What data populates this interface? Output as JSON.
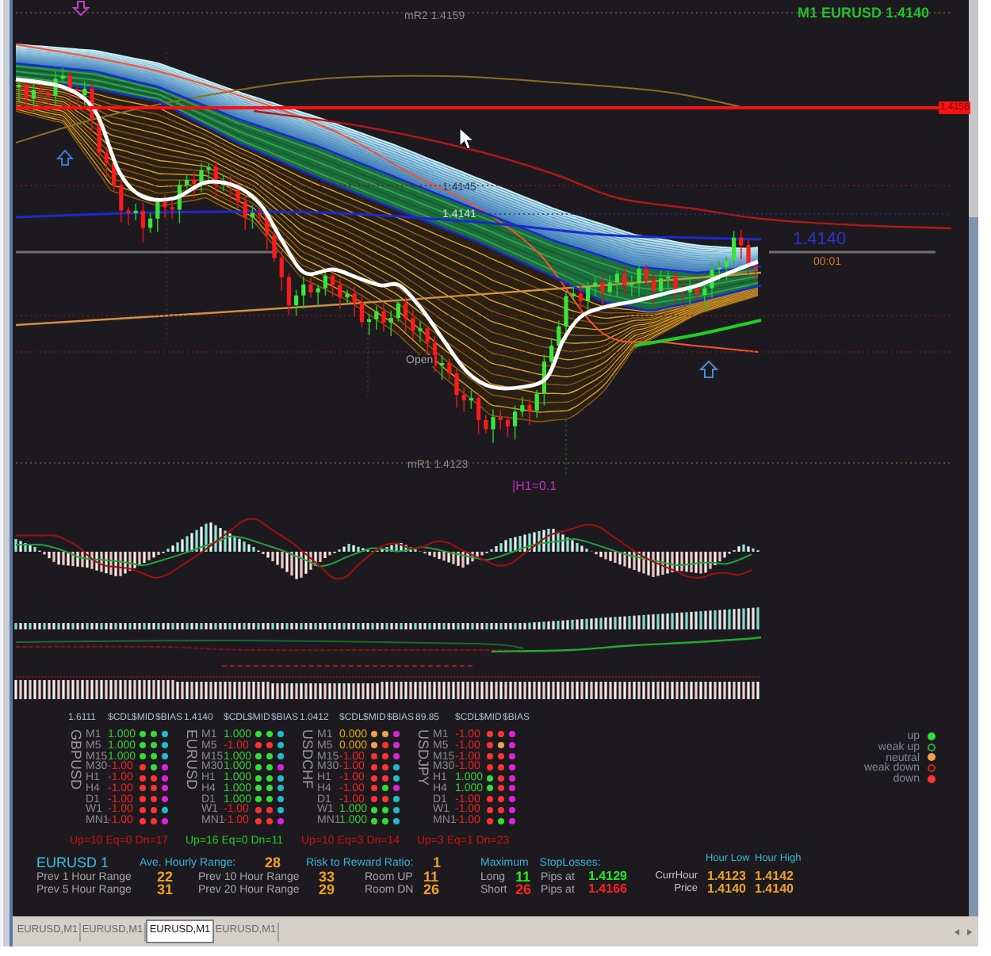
{
  "chart": {
    "title": "M1 EURUSD 1.4140",
    "levels": [
      {
        "label": "mR2 1.4159"
      },
      {
        "label": "1.4145"
      },
      {
        "label": "1.4141"
      },
      {
        "label": "Open"
      },
      {
        "label": "mR1 1.4123"
      }
    ],
    "price_tag": "1.4158",
    "current_price": "1.4140",
    "countdown": "00:01",
    "indicator_label": "|H1=0.1"
  },
  "pairs": [
    {
      "price": "1.6111",
      "columns": [
        "$CDL",
        "$MID",
        "$BIAS"
      ],
      "name": "GBPUSD",
      "rows": [
        {
          "timeframe": "M1",
          "value": "1.000",
          "color": "#33cc33",
          "dots": [
            {
              "color": "#33dd33"
            },
            {
              "color": "#33dd33"
            },
            {
              "color": "#22bbcc"
            }
          ]
        },
        {
          "timeframe": "M5",
          "value": "1.000",
          "color": "#33cc33",
          "dots": [
            {
              "color": "#33dd33"
            },
            {
              "color": "#33dd33"
            },
            {
              "color": "#22bbcc"
            }
          ]
        },
        {
          "timeframe": "M15",
          "value": "1.000",
          "color": "#33cc33",
          "dots": [
            {
              "color": "#33dd33"
            },
            {
              "color": "#33dd33"
            },
            {
              "color": "#22bbcc"
            }
          ]
        },
        {
          "timeframe": "M30",
          "value": "-1.00",
          "color": "#ee2222",
          "dots": [
            {
              "color": "#ff3333"
            },
            {
              "color": "#33dd33"
            },
            {
              "color": "#dd22dd"
            }
          ]
        },
        {
          "timeframe": "H1",
          "value": "-1.00",
          "color": "#ee2222",
          "dots": [
            {
              "color": "#ff3333"
            },
            {
              "color": "#ff3333"
            },
            {
              "color": "#dd22dd"
            }
          ]
        },
        {
          "timeframe": "H4",
          "value": "-1.00",
          "color": "#ee2222",
          "dots": [
            {
              "color": "#ff3333"
            },
            {
              "color": "#ff3333"
            },
            {
              "color": "#dd22dd"
            }
          ]
        },
        {
          "timeframe": "D1",
          "value": "-1.00",
          "color": "#ee2222",
          "dots": [
            {
              "color": "#ff3333"
            },
            {
              "color": "#ff3333"
            },
            {
              "color": "#dd22dd"
            }
          ]
        },
        {
          "timeframe": "W1",
          "value": "-1.00",
          "color": "#ee2222",
          "dots": [
            {
              "color": "#ff3333"
            },
            {
              "color": "#ff3333"
            },
            {
              "color": "#22bbcc"
            }
          ]
        },
        {
          "timeframe": "MN1",
          "value": "-1.00",
          "color": "#ee2222",
          "dots": [
            {
              "color": "#ff3333"
            },
            {
              "color": "#ff3333"
            },
            {
              "color": "#dd22dd"
            }
          ]
        }
      ],
      "summary": {
        "text": "Up=10 Eq=0 Dn=17",
        "color": "#cc1111"
      }
    },
    {
      "price": "1.4140",
      "columns": [
        "$CDL",
        "$MID",
        "$BIAS"
      ],
      "name": "EURUSD",
      "rows": [
        {
          "timeframe": "M1",
          "value": "1.000",
          "color": "#33cc33",
          "dots": [
            {
              "color": "#33dd33"
            },
            {
              "color": "#33dd33"
            },
            {
              "color": "#22bbcc"
            }
          ]
        },
        {
          "timeframe": "M5",
          "value": "-1.00",
          "color": "#ee2222",
          "dots": [
            {
              "color": "#ff3333"
            },
            {
              "color": "#ff3333"
            },
            {
              "color": "#22bbcc"
            }
          ]
        },
        {
          "timeframe": "M15",
          "value": "1.000",
          "color": "#33cc33",
          "dots": [
            {
              "color": "#33dd33"
            },
            {
              "color": "#33dd33"
            },
            {
              "color": "#22bbcc"
            }
          ]
        },
        {
          "timeframe": "M30",
          "value": "1.000",
          "color": "#33cc33",
          "dots": [
            {
              "color": "#33dd33"
            },
            {
              "color": "#33dd33"
            },
            {
              "color": "#dd22dd"
            }
          ]
        },
        {
          "timeframe": "H1",
          "value": "1.000",
          "color": "#33cc33",
          "dots": [
            {
              "color": "#33dd33"
            },
            {
              "color": "#33dd33"
            },
            {
              "color": "#22bbcc"
            }
          ]
        },
        {
          "timeframe": "H4",
          "value": "1.000",
          "color": "#33cc33",
          "dots": [
            {
              "color": "#33dd33"
            },
            {
              "color": "#33dd33"
            },
            {
              "color": "#22bbcc"
            }
          ]
        },
        {
          "timeframe": "D1",
          "value": "1.000",
          "color": "#33cc33",
          "dots": [
            {
              "color": "#33dd33"
            },
            {
              "color": "#33dd33"
            },
            {
              "color": "#22bbcc"
            }
          ]
        },
        {
          "timeframe": "W1",
          "value": "-1.00",
          "color": "#ee2222",
          "dots": [
            {
              "color": "#ff3333"
            },
            {
              "color": "#ff3333"
            },
            {
              "color": "#22bbcc"
            }
          ]
        },
        {
          "timeframe": "MN1",
          "value": "-1.00",
          "color": "#ee2222",
          "dots": [
            {
              "color": "#ff3333"
            },
            {
              "color": "#ff3333"
            },
            {
              "color": "#dd22dd"
            }
          ]
        }
      ],
      "summary": {
        "text": "Up=16 Eq=0 Dn=11",
        "color": "#22cc22"
      }
    },
    {
      "price": "1.0412",
      "columns": [
        "$CDL",
        "$MID",
        "$BIAS"
      ],
      "name": "USDCHF",
      "rows": [
        {
          "timeframe": "M1",
          "value": "0.000",
          "color": "#ddaa00",
          "dots": [
            {
              "color": "#eea050"
            },
            {
              "color": "#eea050"
            },
            {
              "color": "#dd22dd"
            }
          ]
        },
        {
          "timeframe": "M5",
          "value": "0.000",
          "color": "#ddaa00",
          "dots": [
            {
              "color": "#eea050"
            },
            {
              "color": "#ff3333"
            },
            {
              "color": "#dd22dd"
            }
          ]
        },
        {
          "timeframe": "M15",
          "value": "-1.00",
          "color": "#ee2222",
          "dots": [
            {
              "color": "#ff3333"
            },
            {
              "color": "#ff3333"
            },
            {
              "color": "#dd22dd"
            }
          ]
        },
        {
          "timeframe": "M30",
          "value": "-1.00",
          "color": "#ee2222",
          "dots": [
            {
              "color": "#ff3333"
            },
            {
              "color": "#ff3333"
            },
            {
              "color": "#22bbcc"
            }
          ]
        },
        {
          "timeframe": "H1",
          "value": "-1.00",
          "color": "#ee2222",
          "dots": [
            {
              "color": "#ff3333"
            },
            {
              "color": "#ff3333"
            },
            {
              "color": "#22bbcc"
            }
          ]
        },
        {
          "timeframe": "H4",
          "value": "-1.00",
          "color": "#ee2222",
          "dots": [
            {
              "color": "#ff3333"
            },
            {
              "color": "#33dd33"
            },
            {
              "color": "#dd22dd"
            }
          ]
        },
        {
          "timeframe": "D1",
          "value": "-1.00",
          "color": "#ee2222",
          "dots": [
            {
              "color": "#ff3333"
            },
            {
              "color": "#ff3333"
            },
            {
              "color": "#22bbcc"
            }
          ]
        },
        {
          "timeframe": "W1",
          "value": "1.000",
          "color": "#33cc33",
          "dots": [
            {
              "color": "#33dd33"
            },
            {
              "color": "#33dd33"
            },
            {
              "color": "#22bbcc"
            }
          ]
        },
        {
          "timeframe": "MN1",
          "value": "1.000",
          "color": "#33cc33",
          "dots": [
            {
              "color": "#33dd33"
            },
            {
              "color": "#33dd33"
            },
            {
              "color": "#22bbcc"
            }
          ]
        }
      ],
      "summary": {
        "text": "Up=10 Eq=3 Dn=14",
        "color": "#cc1111"
      }
    },
    {
      "price": "89.85",
      "columns": [
        "$CDL",
        "$MID",
        "$BIAS"
      ],
      "name": "USDJPY",
      "rows": [
        {
          "timeframe": "M1",
          "value": "-1.00",
          "color": "#ee2222",
          "dots": [
            {
              "color": "#ff3333"
            },
            {
              "color": "#ff3333"
            },
            {
              "color": "#dd22dd"
            }
          ]
        },
        {
          "timeframe": "M5",
          "value": "-1.00",
          "color": "#ee2222",
          "dots": [
            {
              "color": "#ff3333"
            },
            {
              "color": "#eea050"
            },
            {
              "color": "#dd22dd"
            }
          ]
        },
        {
          "timeframe": "M15",
          "value": "-1.00",
          "color": "#ee2222",
          "dots": [
            {
              "color": "#ff3333"
            },
            {
              "color": "#ff3333"
            },
            {
              "color": "#dd22dd"
            }
          ]
        },
        {
          "timeframe": "M30",
          "value": "-1.00",
          "color": "#ee2222",
          "dots": [
            {
              "color": "#ff3333"
            },
            {
              "color": "#ff3333"
            },
            {
              "color": "#dd22dd"
            }
          ]
        },
        {
          "timeframe": "H1",
          "value": "1.000",
          "color": "#33cc33",
          "dots": [
            {
              "color": "#33dd33"
            },
            {
              "color": "#ff3333"
            },
            {
              "color": "#dd22dd"
            }
          ]
        },
        {
          "timeframe": "H4",
          "value": "1.000",
          "color": "#33cc33",
          "dots": [
            {
              "color": "#33dd33"
            },
            {
              "color": "#ff3333"
            },
            {
              "color": "#dd22dd"
            }
          ]
        },
        {
          "timeframe": "D1",
          "value": "-1.00",
          "color": "#ee2222",
          "dots": [
            {
              "color": "#ff3333"
            },
            {
              "color": "#ff3333"
            },
            {
              "color": "#dd22dd"
            }
          ]
        },
        {
          "timeframe": "W1",
          "value": "-1.00",
          "color": "#ee2222",
          "dots": [
            {
              "color": "#ff3333"
            },
            {
              "color": "#ff3333"
            },
            {
              "color": "#dd22dd"
            }
          ]
        },
        {
          "timeframe": "MN1",
          "value": "-1.00",
          "color": "#ee2222",
          "dots": [
            {
              "color": "#ff3333"
            },
            {
              "color": "#33dd33"
            },
            {
              "color": "#dd22dd"
            }
          ]
        }
      ],
      "summary": {
        "text": "Up=3 Eq=1 Dn=23",
        "color": "#cc1111"
      }
    }
  ],
  "legend": [
    {
      "label": "up",
      "kind": "dot",
      "color": "#33dd33"
    },
    {
      "label": "weak up",
      "kind": "ring",
      "color": "#22aa44"
    },
    {
      "label": "neutral",
      "kind": "dot",
      "color": "#eea050"
    },
    {
      "label": "weak down",
      "kind": "ring",
      "color": "#cc2222"
    },
    {
      "label": "down",
      "kind": "dot",
      "color": "#ff3333"
    }
  ],
  "stats": {
    "title": "EURUSD 1",
    "ave_hourly_range": {
      "label": "Ave. Hourly Range:",
      "value": "28"
    },
    "risk_reward": {
      "label": "Risk to Reward Ratio:",
      "value": "1"
    },
    "stoploss_heading": "Maximum StopLosses:",
    "hour_columns": [
      "Hour Low",
      "Hour High"
    ],
    "rows": [
      {
        "short_range": {
          "label": "Prev 1 Hour Range",
          "value": "22"
        },
        "long_range": {
          "label": "Prev 10 Hour Range",
          "value": "33"
        },
        "room": {
          "label": "Room UP",
          "value": "11"
        },
        "stoploss": {
          "label": "Long",
          "pips": "11",
          "pips_label": "Pips at",
          "price": "1.4129",
          "color": "#22ee22"
        },
        "hour": {
          "label": "CurrHour",
          "values": [
            "1.4123",
            "1.4142"
          ]
        }
      },
      {
        "short_range": {
          "label": "Prev 5 Hour Range",
          "value": "31"
        },
        "long_range": {
          "label": "Prev 20 Hour Range",
          "value": "29"
        },
        "room": {
          "label": "Room DN",
          "value": "26"
        },
        "stoploss": {
          "label": "Short",
          "pips": "26",
          "pips_label": "Pips at",
          "price": "1.4166",
          "color": "#ff2222"
        },
        "hour": {
          "label": "Price",
          "values": [
            "1.4140",
            "1.4140"
          ]
        }
      }
    ]
  },
  "tabs": [
    {
      "label": "EURUSD,M1",
      "selected": false
    },
    {
      "label": "EURUSD,M1",
      "selected": false
    },
    {
      "label": "EURUSD,M1",
      "selected": true
    },
    {
      "label": "EURUSD,M1",
      "selected": false
    }
  ]
}
